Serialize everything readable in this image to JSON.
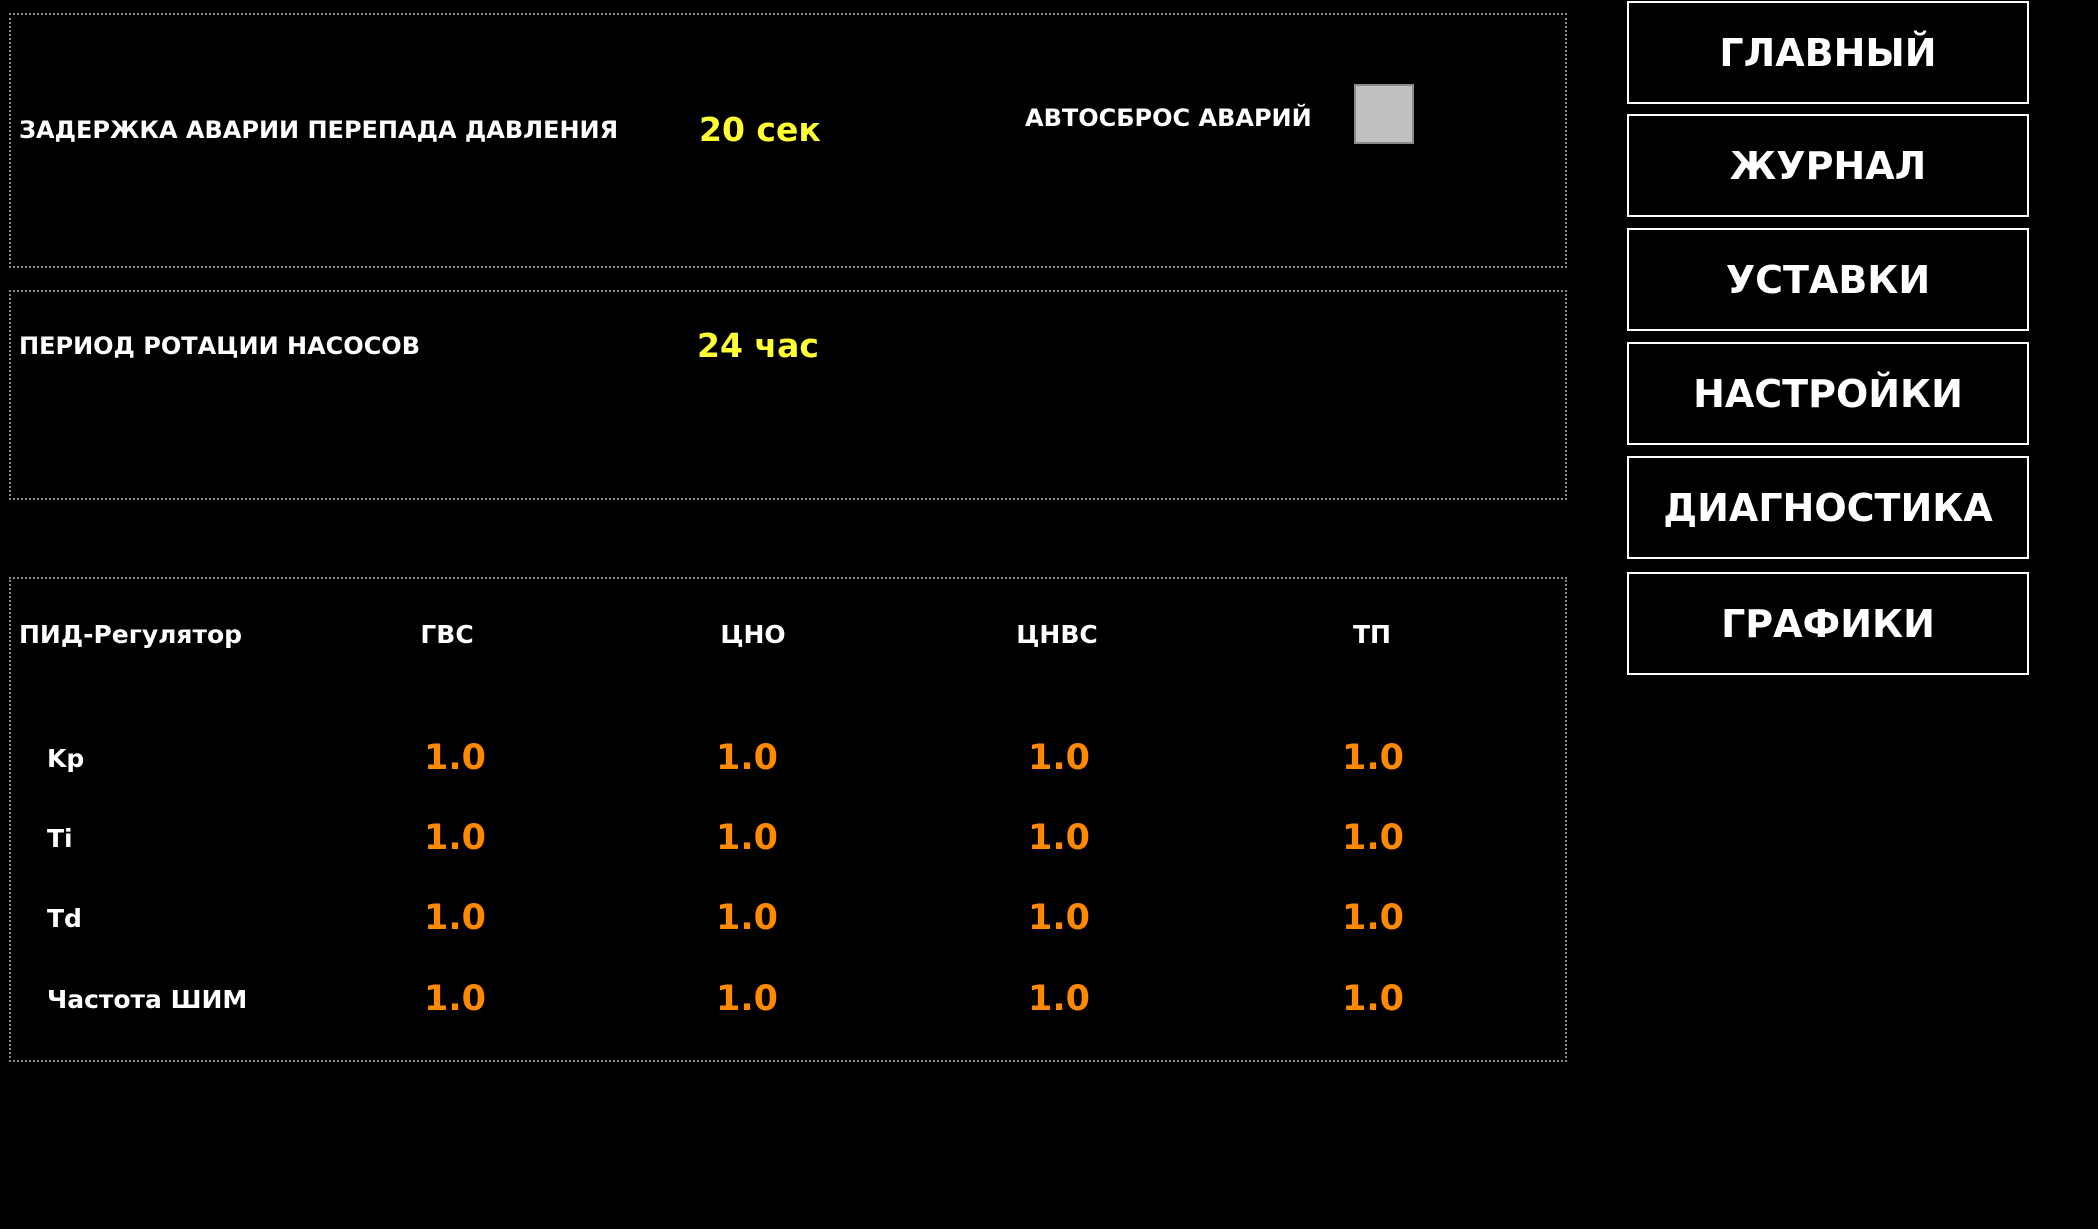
{
  "settings": {
    "pressure_alarm_delay": {
      "label": "ЗАДЕРЖКА АВАРИИ ПЕРЕПАДА ДАВЛЕНИЯ",
      "value": "20 сек"
    },
    "auto_reset": {
      "label": "АВТОСБРОС АВАРИЙ",
      "checked": false
    },
    "pump_rotation": {
      "label": "ПЕРИОД РОТАЦИИ НАСОСОВ",
      "value": "24 час"
    }
  },
  "pid": {
    "title": "ПИД-Регулятор",
    "columns": [
      "ГВС",
      "ЦНО",
      "ЦНВС",
      "ТП"
    ],
    "rows": [
      {
        "label": "Kp",
        "values": [
          "1.0",
          "1.0",
          "1.0",
          "1.0"
        ]
      },
      {
        "label": "Ti",
        "values": [
          "1.0",
          "1.0",
          "1.0",
          "1.0"
        ]
      },
      {
        "label": "Td",
        "values": [
          "1.0",
          "1.0",
          "1.0",
          "1.0"
        ]
      },
      {
        "label": "Частота ШИМ",
        "values": [
          "1.0",
          "1.0",
          "1.0",
          "1.0"
        ]
      }
    ]
  },
  "nav": {
    "main": "ГЛАВНЫЙ",
    "journal": "ЖУРНАЛ",
    "setpoints": "УСТАВКИ",
    "settings": "НАСТРОЙКИ",
    "diagnostics": "ДИАГНОСТИКА",
    "graphs": "ГРАФИКИ"
  },
  "colors": {
    "background": "#000000",
    "setting_value": "#ffff33",
    "pid_value": "#ff8a00",
    "checkbox": "#c0c0c0"
  }
}
